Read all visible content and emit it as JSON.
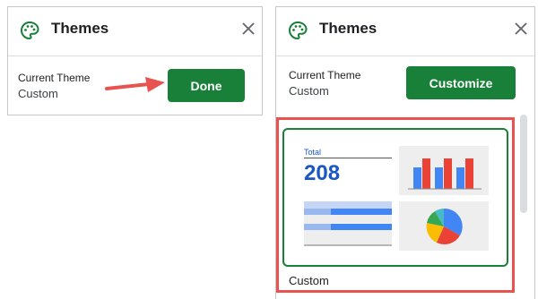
{
  "left_panel": {
    "title": "Themes",
    "current_theme_label": "Current Theme",
    "current_theme_value": "Custom",
    "done_label": "Done"
  },
  "right_panel": {
    "title": "Themes",
    "current_theme_label": "Current Theme",
    "current_theme_value": "Custom",
    "customize_label": "Customize",
    "theme_card": {
      "label": "Custom",
      "preview": {
        "total_label": "Total",
        "total_value": "208"
      }
    }
  },
  "colors": {
    "accent_green": "#188038",
    "annotation_red": "#e8534f",
    "blue": "#4285f4",
    "red": "#ea4335",
    "yellow": "#fbbc04",
    "green": "#34a853",
    "teal": "#46bdc6"
  },
  "icons": [
    "palette-icon",
    "close-icon",
    "arrow-annotation"
  ]
}
